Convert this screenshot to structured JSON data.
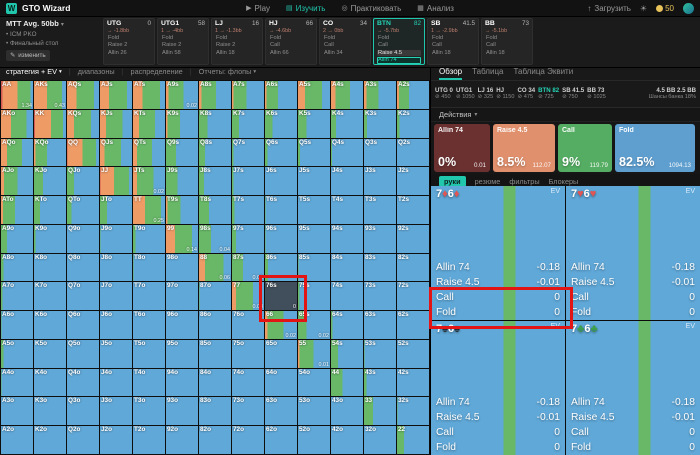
{
  "topbar": {
    "logo_mark": "W",
    "logo_text": "GTO Wizard",
    "nav": [
      {
        "id": "play",
        "icon": "play-icon",
        "label": "Play",
        "active": false
      },
      {
        "id": "study",
        "icon": "study-icon",
        "label": "Изучить",
        "active": true
      },
      {
        "id": "practice",
        "icon": "target-icon",
        "label": "Практиковать",
        "active": false
      },
      {
        "id": "analyze",
        "icon": "chart-icon",
        "label": "Анализ",
        "active": false
      }
    ],
    "upload_label": "Загрузить",
    "credits": "50"
  },
  "scenario": {
    "title": "MTT Avg. 50bb",
    "items": [
      "ICM PKO",
      "Финальный стол"
    ],
    "edit_label": "изменить"
  },
  "positions": [
    {
      "name": "UTG",
      "stack": "0",
      "delta": "→ -1.8bb",
      "active": false,
      "actions": [
        [
          "Fold",
          0
        ],
        [
          "Raise 2",
          0
        ],
        [
          "Allin 26",
          0
        ]
      ]
    },
    {
      "name": "UTG1",
      "stack": "58",
      "delta": "1 → -4bb",
      "active": false,
      "actions": [
        [
          "Fold",
          0
        ],
        [
          "Raise 2",
          0
        ],
        [
          "Allin 58",
          0
        ]
      ]
    },
    {
      "name": "LJ",
      "stack": "16",
      "delta": "1 → -1.3bb",
      "active": false,
      "actions": [
        [
          "Fold",
          0
        ],
        [
          "Raise 2",
          0
        ],
        [
          "Allin 18",
          0
        ]
      ]
    },
    {
      "name": "HJ",
      "stack": "66",
      "delta": "→ -4.6bb",
      "active": false,
      "actions": [
        [
          "Fold",
          0
        ],
        [
          "Call",
          0
        ],
        [
          "Allin 66",
          0
        ]
      ]
    },
    {
      "name": "CO",
      "stack": "34",
      "delta": "2 → 0bb",
      "active": false,
      "actions": [
        [
          "Fold",
          0
        ],
        [
          "Call",
          0
        ],
        [
          "Allin 34",
          0
        ]
      ]
    },
    {
      "name": "BTN",
      "stack": "82",
      "delta": "→ -5.7bb",
      "active": true,
      "actions": [
        [
          "Fold",
          0
        ],
        [
          "Call",
          0
        ],
        [
          "Raise 4.5",
          1
        ],
        [
          "Allin 74",
          2
        ]
      ]
    },
    {
      "name": "SB",
      "stack": "41.5",
      "delta": "1 → -2.9bb",
      "active": false,
      "actions": [
        [
          "Fold",
          0
        ],
        [
          "Call",
          0
        ],
        [
          "Allin 18",
          0
        ]
      ]
    },
    {
      "name": "BB",
      "stack": "73",
      "delta": "→ -5.1bb",
      "active": false,
      "actions": [
        [
          "Fold",
          0
        ],
        [
          "Call",
          0
        ],
        [
          "Allin 18",
          0
        ]
      ]
    }
  ],
  "left_toolbar": {
    "items": [
      {
        "label": "стратегия + EV",
        "caret": true,
        "active": true
      },
      {
        "label": "диапазоны",
        "caret": false,
        "active": false
      },
      {
        "label": "распределение",
        "caret": false,
        "active": false
      },
      {
        "label": "Отчеты: флопы",
        "caret": true,
        "active": false
      }
    ]
  },
  "matrix": {
    "ranks": [
      "A",
      "K",
      "Q",
      "J",
      "T",
      "9",
      "8",
      "7",
      "6",
      "5",
      "4",
      "3",
      "2"
    ],
    "selected": "76s",
    "strategies": [
      [
        "4,48,40,8",
        "0,40,48,12",
        "0,30,55,15",
        "0,28,57,15",
        "0,30,55,15",
        "0,8,47,45",
        "0,8,45,47",
        "0,5,40,55",
        "0,4,36,60",
        "0,22,53,25",
        "0,14,46,40",
        "0,8,37,55",
        "0,6,32,62"
      ],
      [
        "0,32,48,20",
        "3,50,38,9",
        "0,22,53,25",
        "0,18,52,30",
        "0,18,50,32",
        "0,4,40,56",
        "0,0,26,74",
        "0,0,22,78",
        "0,0,24,76",
        "0,0,26,74",
        "0,0,16,84",
        "0,0,10,90",
        "0,0,8,92"
      ],
      [
        "0,18,47,35",
        "0,4,36,60",
        "2,46,42,10",
        "0,14,52,34",
        "0,12,48,40",
        "0,0,32,68",
        "0,0,18,82",
        "0,0,4,96",
        "0,0,8,92",
        "0,0,6,94",
        "0,0,3,97",
        "0,0,0,100",
        "0,0,0,100"
      ],
      [
        "0,10,42,48",
        "0,0,28,72",
        "0,0,22,78",
        "2,42,46,10",
        "0,12,52,36",
        "0,0,36,64",
        "0,0,16,84",
        "0,0,4,96",
        "0,0,0,100",
        "0,0,0,100",
        "0,0,0,100",
        "0,0,0,100",
        "0,0,0,100"
      ],
      [
        "0,6,38,56",
        "0,0,18,82",
        "0,0,14,86",
        "0,0,22,78",
        "0,38,50,12",
        "0,4,42,54",
        "0,0,32,68",
        "0,0,8,92",
        "0,0,2,98",
        "0,0,0,100",
        "0,0,0,100",
        "0,0,0,100",
        "0,0,0,100"
      ],
      [
        "0,0,18,82",
        "0,0,4,96",
        "0,0,0,100",
        "0,0,2,98",
        "0,0,8,92",
        "0,28,54,18",
        "0,0,38,62",
        "0,0,12,88",
        "0,0,2,98",
        "0,0,0,100",
        "0,0,0,100",
        "0,0,0,100",
        "0,0,0,100"
      ],
      [
        "0,0,8,92",
        "0,0,0,100",
        "0,0,0,100",
        "0,0,0,100",
        "0,0,2,98",
        "0,0,0,100",
        "0,18,58,24",
        "0,0,34,66",
        "0,0,10,90",
        "0,0,2,98",
        "0,0,0,100",
        "0,0,0,100",
        "0,0,0,100"
      ],
      [
        "0,0,4,96",
        "0,0,0,100",
        "0,0,0,100",
        "0,0,0,100",
        "0,0,0,100",
        "0,0,0,100",
        "0,0,2,98",
        "0,12,54,34",
        "0,0,24,76",
        "0,0,4,96",
        "0,0,0,100",
        "0,0,0,100",
        "0,0,0,100"
      ],
      [
        "0,0,2,98",
        "0,0,0,100",
        "0,0,0,100",
        "0,0,0,100",
        "0,0,0,100",
        "0,0,0,100",
        "0,0,0,100",
        "0,0,0,100",
        "0,8,50,42",
        "0,0,26,74",
        "0,0,4,96",
        "0,0,0,100",
        "0,0,0,100"
      ],
      [
        "0,0,8,92",
        "0,0,0,100",
        "0,0,0,100",
        "0,0,0,100",
        "0,0,0,100",
        "0,0,0,100",
        "0,0,0,100",
        "0,0,0,100",
        "0,0,0,100",
        "0,4,44,52",
        "0,0,22,78",
        "0,0,2,98",
        "0,0,0,100"
      ],
      [
        "0,0,2,98",
        "0,0,0,100",
        "0,0,0,100",
        "0,0,0,100",
        "0,0,0,100",
        "0,0,0,100",
        "0,0,0,100",
        "0,0,0,100",
        "0,0,0,100",
        "0,0,0,100",
        "0,0,36,64",
        "0,0,8,92",
        "0,0,0,100"
      ],
      [
        "0,0,0,100",
        "0,0,0,100",
        "0,0,0,100",
        "0,0,0,100",
        "0,0,0,100",
        "0,0,0,100",
        "0,0,0,100",
        "0,0,0,100",
        "0,0,0,100",
        "0,0,0,100",
        "0,0,0,100",
        "0,0,28,72",
        "0,0,2,98"
      ],
      [
        "0,0,0,100",
        "0,0,0,100",
        "0,0,0,100",
        "0,0,0,100",
        "0,0,0,100",
        "0,0,0,100",
        "0,0,0,100",
        "0,0,0,100",
        "0,0,0,100",
        "0,0,0,100",
        "0,0,0,100",
        "0,0,0,100",
        "0,0,22,78"
      ]
    ],
    "values": {
      "AA": "1.34",
      "AKs": "0.43",
      "A9s": "0.02",
      "TT": "0.25",
      "JTs": "0.02",
      "99": "0.14",
      "98s": "0.04",
      "88": "0.06",
      "87s": "0.08",
      "77": "0.08",
      "76s": "0",
      "66": "0.02",
      "65s": "0.02",
      "55": "0.01"
    }
  },
  "overview": {
    "tabs": [
      {
        "label": "Обзор",
        "active": true
      },
      {
        "label": "Таблица",
        "active": false
      },
      {
        "label": "Таблица Эквити",
        "active": false
      }
    ],
    "chips": [
      {
        "pos": "UTG",
        "val": "0",
        "sub": "450",
        "active": false
      },
      {
        "pos": "UTG1",
        "val": "",
        "sub": "1050",
        "active": false
      },
      {
        "pos": "LJ",
        "val": "16",
        "sub": "325",
        "active": false
      },
      {
        "pos": "HJ",
        "val": "",
        "sub": "1150",
        "active": false
      },
      {
        "pos": "CO",
        "val": "34",
        "sub": "475",
        "active": false
      },
      {
        "pos": "BTN",
        "val": "82",
        "sub": "725",
        "active": true
      },
      {
        "pos": "SB",
        "val": "41.5",
        "sub": "750",
        "active": false
      },
      {
        "pos": "BB",
        "val": "73",
        "sub": "1025",
        "active": false
      }
    ],
    "pot": {
      "line1": "4.5 BB  2.5 BB",
      "line2": "Шансы банка 18%"
    },
    "actions_label": "Действия",
    "actions": [
      {
        "name": "Allin 74",
        "pct": "0%",
        "ev": "0.01",
        "key": "allin"
      },
      {
        "name": "Raise 4.5",
        "pct": "8.5%",
        "ev": "112.07",
        "key": "raise"
      },
      {
        "name": "Call",
        "pct": "9%",
        "ev": "119.79",
        "key": "call"
      },
      {
        "name": "Fold",
        "pct": "82.5%",
        "ev": "1094.13",
        "key": "fold"
      }
    ],
    "subtabs": [
      {
        "label": "руки",
        "active": true
      },
      {
        "label": "резюме",
        "active": false
      },
      {
        "label": "фильтры",
        "active": false
      },
      {
        "label": "Блокеры",
        "active": false
      }
    ]
  },
  "combos": {
    "ev_label": "EV",
    "items": [
      {
        "cards": "7d6d",
        "rows": [
          [
            "Allin 74",
            "-0.18"
          ],
          [
            "Raise 4.5",
            "-0.01"
          ],
          [
            "Call",
            "0"
          ],
          [
            "Fold",
            "0"
          ]
        ]
      },
      {
        "cards": "7h6h",
        "rows": [
          [
            "Allin 74",
            "-0.18"
          ],
          [
            "Raise 4.5",
            "-0.01"
          ],
          [
            "Call",
            "0"
          ],
          [
            "Fold",
            "0"
          ]
        ]
      },
      {
        "cards": "7s6s",
        "rows": [
          [
            "Allin 74",
            "-0.18"
          ],
          [
            "Raise 4.5",
            "-0.01"
          ],
          [
            "Call",
            "0"
          ],
          [
            "Fold",
            "0"
          ]
        ]
      },
      {
        "cards": "7c6c",
        "rows": [
          [
            "Allin 74",
            "-0.18"
          ],
          [
            "Raise 4.5",
            "-0.01"
          ],
          [
            "Call",
            "0"
          ],
          [
            "Fold",
            "0"
          ]
        ]
      }
    ]
  },
  "colors": {
    "accent": "#21c7ad",
    "allin": "#d65a52",
    "raise": "#ef9b66",
    "call": "#68b868",
    "fold": "#60a8d8",
    "allin_card": "#6b3131",
    "raise_card": "#e0906d",
    "call_card": "#54ad62",
    "fold_card": "#5f9fd0",
    "suits": {
      "s": "#23262e",
      "h": "#e25555",
      "d": "#e25555",
      "c": "#3da04c"
    }
  }
}
